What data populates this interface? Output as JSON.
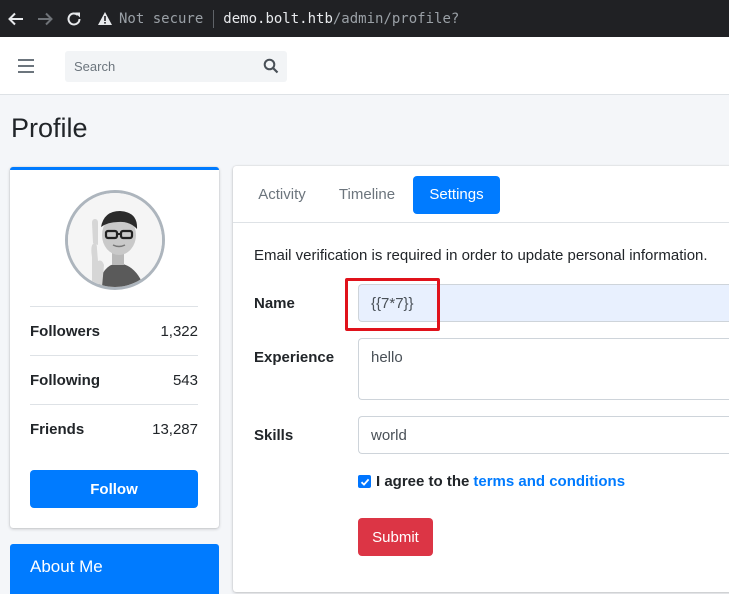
{
  "browser": {
    "security_label": "Not secure",
    "url_host": "demo.bolt.htb",
    "url_path": "/admin/profile?"
  },
  "topbar": {
    "search_placeholder": "Search"
  },
  "page": {
    "title": "Profile"
  },
  "profile": {
    "stats": [
      {
        "label": "Followers",
        "value": "1,322"
      },
      {
        "label": "Following",
        "value": "543"
      },
      {
        "label": "Friends",
        "value": "13,287"
      }
    ],
    "follow_label": "Follow",
    "about_title": "About Me"
  },
  "tabs": [
    {
      "label": "Activity",
      "active": false
    },
    {
      "label": "Timeline",
      "active": false
    },
    {
      "label": "Settings",
      "active": true
    }
  ],
  "settings": {
    "notice": "Email verification is required in order to update personal information.",
    "name_label": "Name",
    "name_value": "{{7*7}}",
    "experience_label": "Experience",
    "experience_value": "hello",
    "skills_label": "Skills",
    "skills_value": "world",
    "agree_text": "I agree to the",
    "agree_link": "terms and conditions",
    "agree_checked": true,
    "submit_label": "Submit"
  },
  "colors": {
    "primary": "#007bff",
    "danger": "#dc3545",
    "highlight": "#e0121b"
  },
  "icons": [
    "back-arrow-icon",
    "forward-arrow-icon",
    "reload-icon",
    "warning-icon",
    "hamburger-menu-icon",
    "search-icon",
    "checkbox-check-icon"
  ]
}
